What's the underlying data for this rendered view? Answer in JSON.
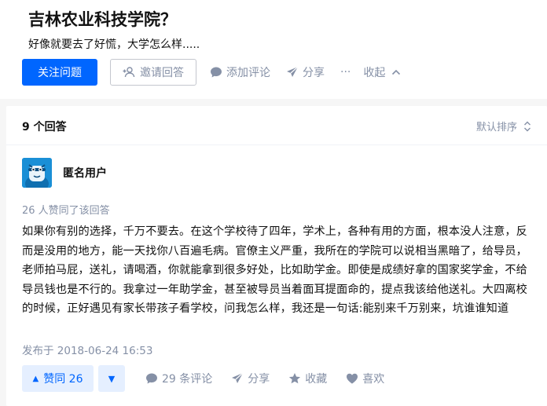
{
  "question": {
    "title": "吉林农业科技学院？",
    "detail": "好像就要去了好慌，大学怎么样....."
  },
  "question_actions": {
    "follow_label": "关注问题",
    "invite_label": "邀请回答",
    "comment_label": "添加评论",
    "share_label": "分享",
    "more_label": "···",
    "collapse_label": "收起"
  },
  "answers_header": {
    "count_label": "9 个回答",
    "sort_label": "默认排序"
  },
  "answer": {
    "author": "匿名用户",
    "votes_line": "26 人赞同了该回答",
    "content": "如果你有别的选择，千万不要去。在这个学校待了四年，学术上，各种有用的方面，根本没人注意，反而是没用的地方，能一天找你八百遍毛病。官僚主义严重，我所在的学院可以说相当黑暗了，给导员，老师拍马屁，送礼，请喝酒，你就能拿到很多好处，比如助学金。即使是成绩好拿的国家奖学金，不给导员钱也是不行的。我拿过一年助学金，甚至被导员当着面耳提面命的，提点我该给他送礼。大四离校的时候，正好遇见有家长带孩子看学校，问我怎么样，我还是一句话:能别来千万别来，坑谁谁知道",
    "published": "发布于 2018-06-24 16:53"
  },
  "answer_actions": {
    "upvote_label": "赞同 26",
    "comments_label": "29 条评论",
    "share_label": "分享",
    "collect_label": "收藏",
    "like_label": "喜欢"
  },
  "colors": {
    "brand_blue": "#0066ff",
    "meta_gray": "#8590a6",
    "avatar_blue": "#1a8fd6"
  },
  "icons": [
    "add-user-icon",
    "comment-icon",
    "paper-plane-icon",
    "chevron-up-icon",
    "sort-icon",
    "anonymous-avatar-icon",
    "triangle-up-icon",
    "triangle-down-icon",
    "star-icon",
    "heart-icon"
  ]
}
